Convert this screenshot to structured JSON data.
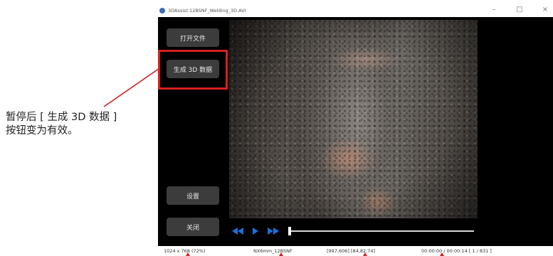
{
  "annotation": {
    "text": "暂停后 [ 生成 3D 数据 ] 按钮变为有效。",
    "color": "#d72020"
  },
  "window": {
    "title": "3DAssist 12BSNF_Welding_3D.AVI",
    "app_icon": "app-logo-icon",
    "controls": {
      "minimize": "–",
      "maximize": "□",
      "close": "×"
    }
  },
  "sidebar": {
    "open_file": "打开文件",
    "generate_3d": "生成 3D 数据",
    "settings": "设置",
    "close": "关闭"
  },
  "player": {
    "icons": [
      "rewind-icon",
      "play-icon",
      "fast-forward-icon"
    ],
    "progress": 0.0,
    "accent": "#1e6fd9"
  },
  "status": {
    "resolution": "1024 x 768 (72%)",
    "model": "NX6mm_12BSNF",
    "coords": "[997,606] [84,82,74]",
    "time": "00:00:00 / 00:00:14 [ 1 / 831 ]"
  }
}
